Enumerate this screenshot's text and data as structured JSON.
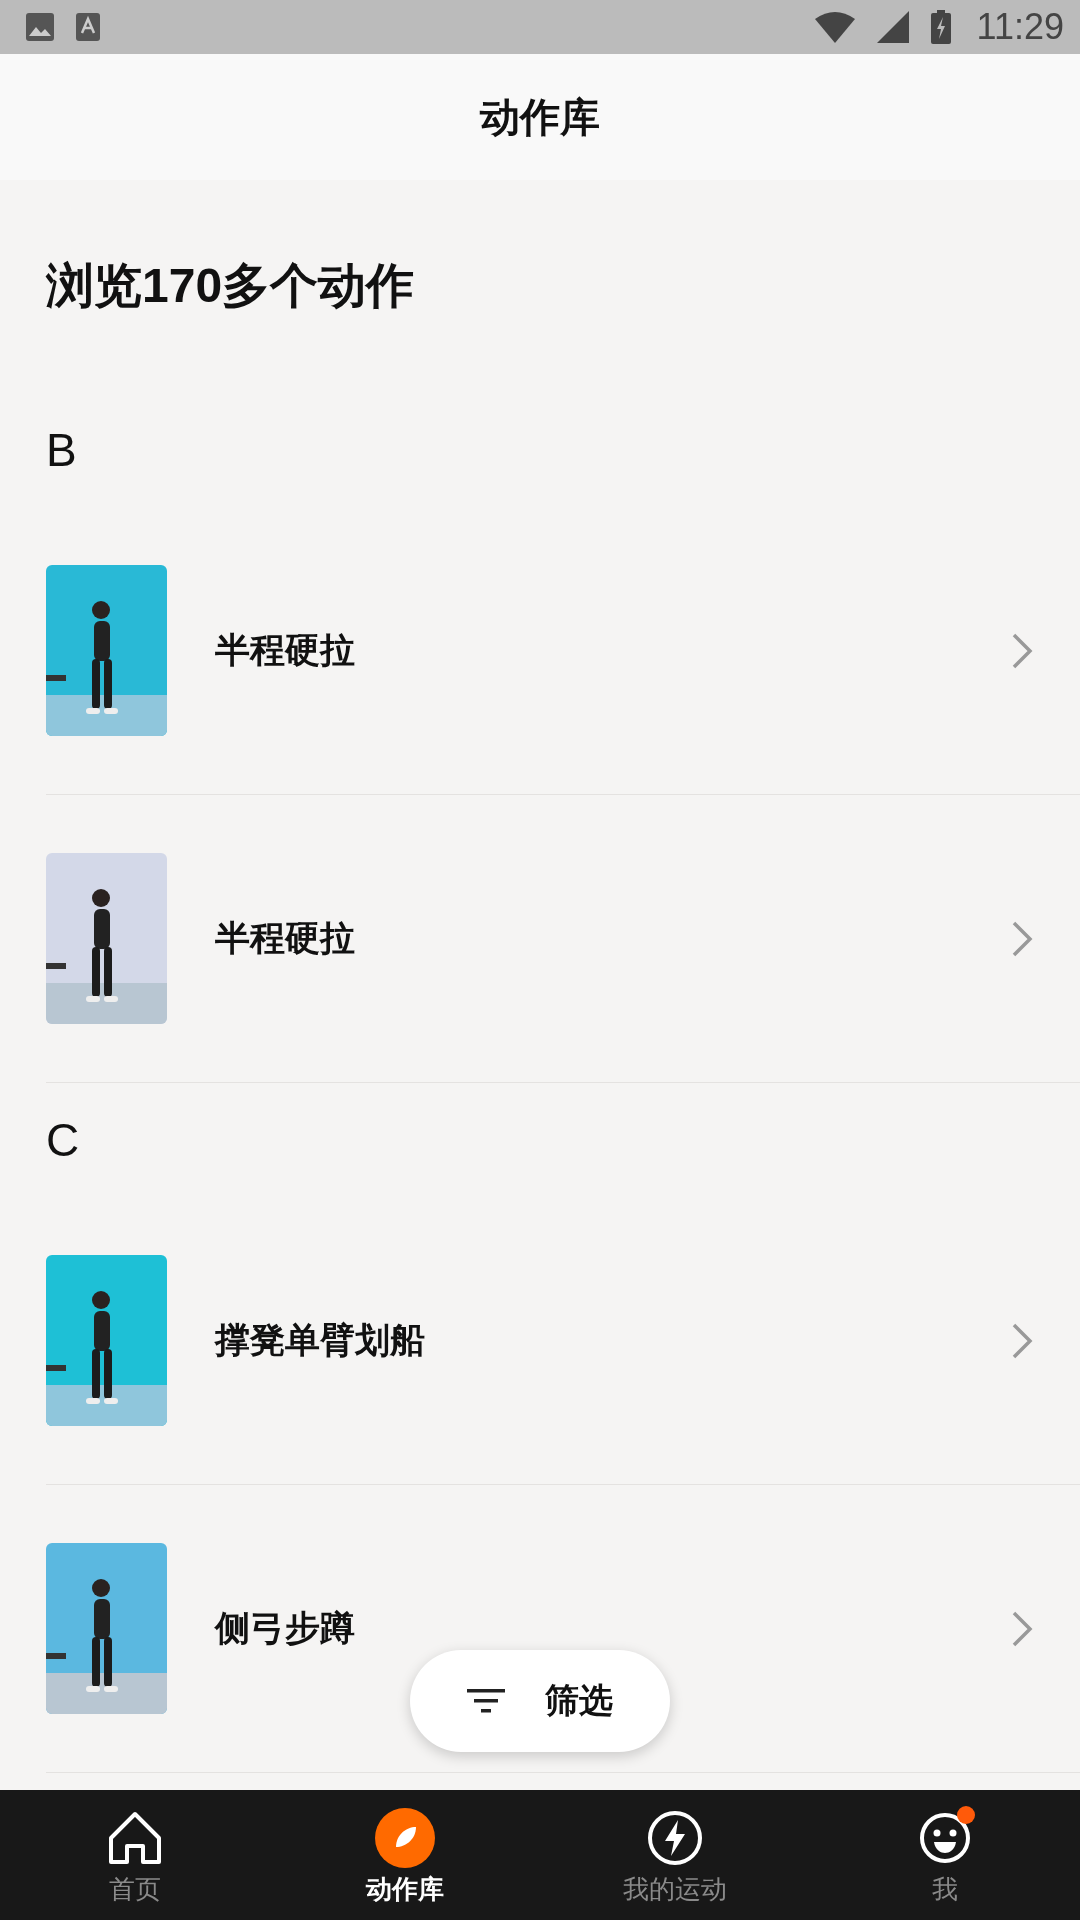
{
  "status_bar": {
    "time": "11:29"
  },
  "header": {
    "title": "动作库"
  },
  "heading": "浏览170多个动作",
  "sections": [
    {
      "letter": "B",
      "exercises": [
        {
          "name": "半程硬拉"
        },
        {
          "name": "半程硬拉"
        }
      ]
    },
    {
      "letter": "C",
      "exercises": [
        {
          "name": "撑凳单臂划船"
        },
        {
          "name": "侧弓步蹲"
        }
      ]
    }
  ],
  "filter_button": {
    "label": "筛选"
  },
  "tab_bar": [
    {
      "label": "首页",
      "selected": false,
      "notification_dot": false
    },
    {
      "label": "动作库",
      "selected": true,
      "notification_dot": false
    },
    {
      "label": "我的运动",
      "selected": false,
      "notification_dot": false
    },
    {
      "label": "我",
      "selected": false,
      "notification_dot": true
    }
  ]
}
